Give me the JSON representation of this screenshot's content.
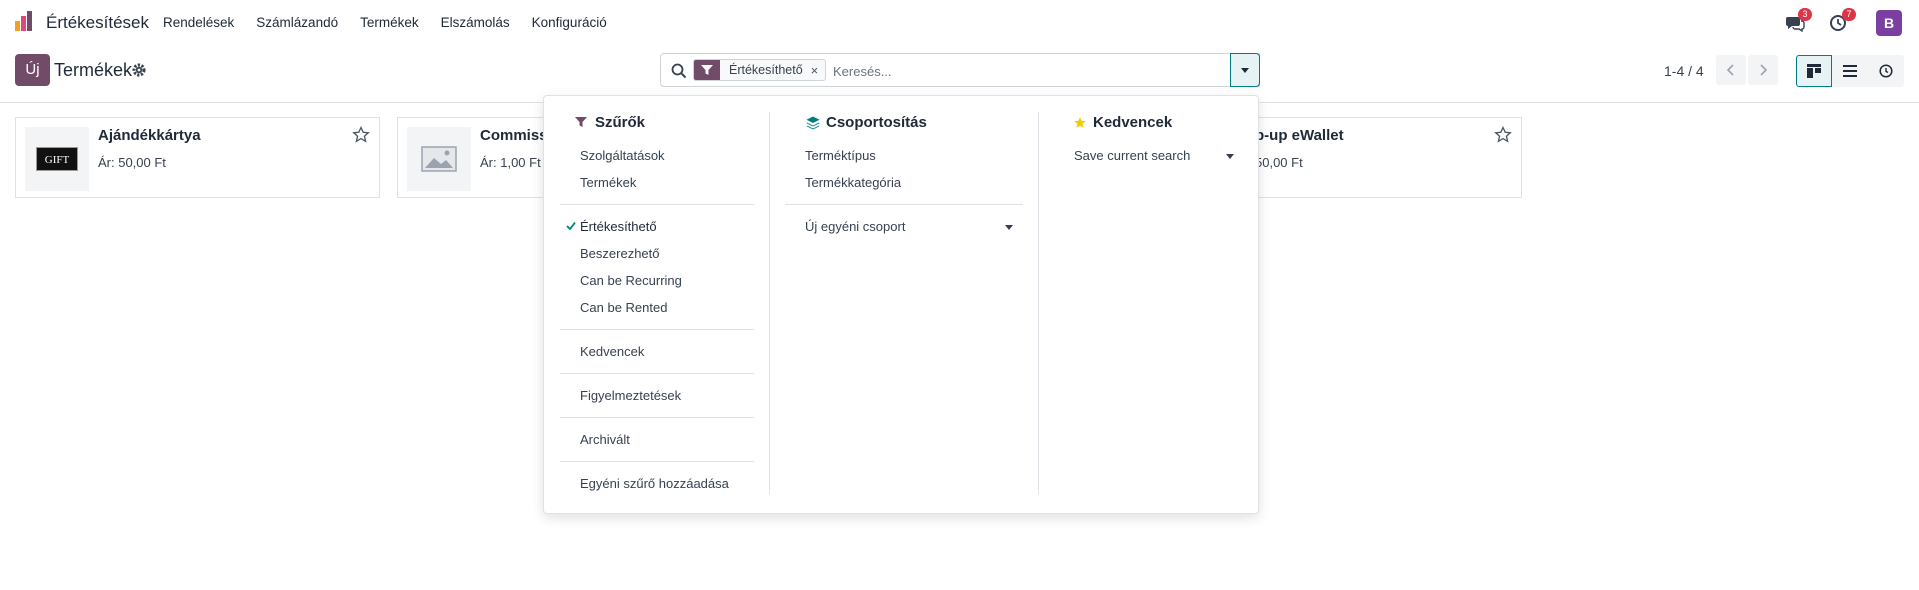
{
  "navbar": {
    "app_name": "Értékesítések",
    "menu": [
      "Rendelések",
      "Számlázandó",
      "Termékek",
      "Elszámolás",
      "Konfiguráció"
    ],
    "messages_badge": "3",
    "activities_badge": "7",
    "avatar_letter": "B"
  },
  "control_panel": {
    "new_label": "Új",
    "title": "Termékek",
    "search": {
      "facet_label": "Értékesíthető",
      "facet_remove": "×",
      "placeholder": "Keresés..."
    },
    "pager": "1-4 / 4"
  },
  "cards": [
    {
      "title": "Ajándékkártya",
      "price": "Ár: 50,00 Ft",
      "image_label": "GIFT"
    },
    {
      "title": "Commissi",
      "price": "Ár: 1,00 Ft"
    },
    {
      "title": "p-up eWallet",
      "price": "50,00 Ft"
    }
  ],
  "dropdown": {
    "filters": {
      "header": "Szűrők",
      "group1": [
        "Szolgáltatások",
        "Termékek"
      ],
      "group2": [
        {
          "label": "Értékesíthető",
          "checked": true
        },
        {
          "label": "Beszerezhető",
          "checked": false
        },
        {
          "label": "Can be Recurring",
          "checked": false
        },
        {
          "label": "Can be Rented",
          "checked": false
        }
      ],
      "favorites": "Kedvencek",
      "warnings": "Figyelmeztetések",
      "archived": "Archivált",
      "add_custom": "Egyéni szűrő hozzáadása"
    },
    "groupby": {
      "header": "Csoportosítás",
      "items": [
        "Terméktípus",
        "Termékkategória"
      ],
      "custom_group": "Új egyéni csoport"
    },
    "favorites": {
      "header": "Kedvencek",
      "save_search": "Save current search"
    }
  },
  "colors": {
    "brand": "#714b67",
    "accent": "#017e84",
    "badge": "#dc3545",
    "star": "#f3cc00"
  }
}
